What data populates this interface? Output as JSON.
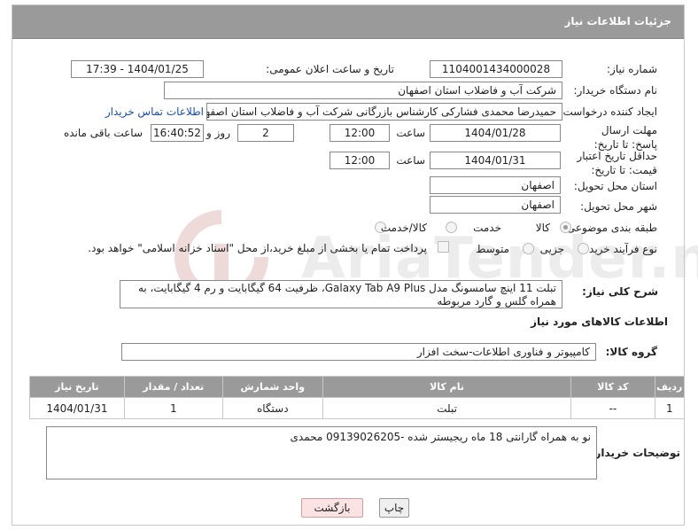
{
  "header": {
    "title": "جزئیات اطلاعات نیاز"
  },
  "need_number": {
    "label": "شماره نیاز:",
    "value": "1104001434000028"
  },
  "announce": {
    "label": "تاریخ و ساعت اعلان عمومی:",
    "value": "1404/01/25 - 17:39"
  },
  "buyer_org": {
    "label": "نام دستگاه خریدار:",
    "value": "شرکت آب و فاضلاب استان اصفهان"
  },
  "creator": {
    "label": "ایجاد کننده درخواست:",
    "value": "حمیدرضا محمدی فشارکی کارشناس بازرگانی شرکت آب و فاضلاب استان اصفهان",
    "contact_link": "اطلاعات تماس خریدار"
  },
  "deadline": {
    "label": "مهلت ارسال پاسخ: تا تاریخ:",
    "date": "1404/01/28",
    "time_label": "ساعت",
    "time": "12:00",
    "days": "2",
    "days_label": "روز و",
    "remaining": "16:40:52",
    "remaining_label": "ساعت باقی مانده"
  },
  "price_validity": {
    "label": "حداقل تاریخ اعتبار قیمت: تا تاریخ:",
    "date": "1404/01/31",
    "time_label": "ساعت",
    "time": "12:00"
  },
  "delivery_province": {
    "label": "استان محل تحویل:",
    "value": "اصفهان"
  },
  "delivery_city": {
    "label": "شهر محل تحویل:",
    "value": "اصفهان"
  },
  "category": {
    "label": "طبقه بندی موضوعی:",
    "options": [
      "کالا",
      "خدمت",
      "کالا/خدمت"
    ]
  },
  "purchase_type": {
    "label": "نوع فرآیند خرید :",
    "options": [
      "جزیی",
      "متوسط"
    ],
    "payment_note": "پرداخت تمام یا بخشی از مبلغ خرید،از محل \"اسناد خزانه اسلامی\" خواهد بود."
  },
  "general_desc": {
    "label": "شرح کلی نیاز:",
    "value": "تبلت 11 اینچ سامسونگ مدل Galaxy Tab A9 Plus، ظرفیت 64 گیگابایت و رم 4 گیگابایت، به همراه گلس و گارد مربوطه"
  },
  "goods_info": {
    "title": "اطلاعات کالاهای مورد نیاز"
  },
  "goods_group": {
    "label": "گروه کالا:",
    "value": "کامپیوتر و فناوری اطلاعات-سخت افزار"
  },
  "table": {
    "headers": [
      "ردیف",
      "کد کالا",
      "نام کالا",
      "واحد شمارش",
      "تعداد / مقدار",
      "تاریخ نیاز"
    ],
    "rows": [
      [
        "1",
        "--",
        "تبلت",
        "دستگاه",
        "1",
        "1404/01/31"
      ]
    ]
  },
  "buyer_notes": {
    "label": "توضیحات خریدار:",
    "value": "نو به همراه گارانتی 18 ماه ریجیستر شده -09139026205 محمدی"
  },
  "buttons": {
    "print": "چاپ",
    "back": "بازگشت"
  },
  "watermark": {
    "text": "AriaTender.neT"
  }
}
